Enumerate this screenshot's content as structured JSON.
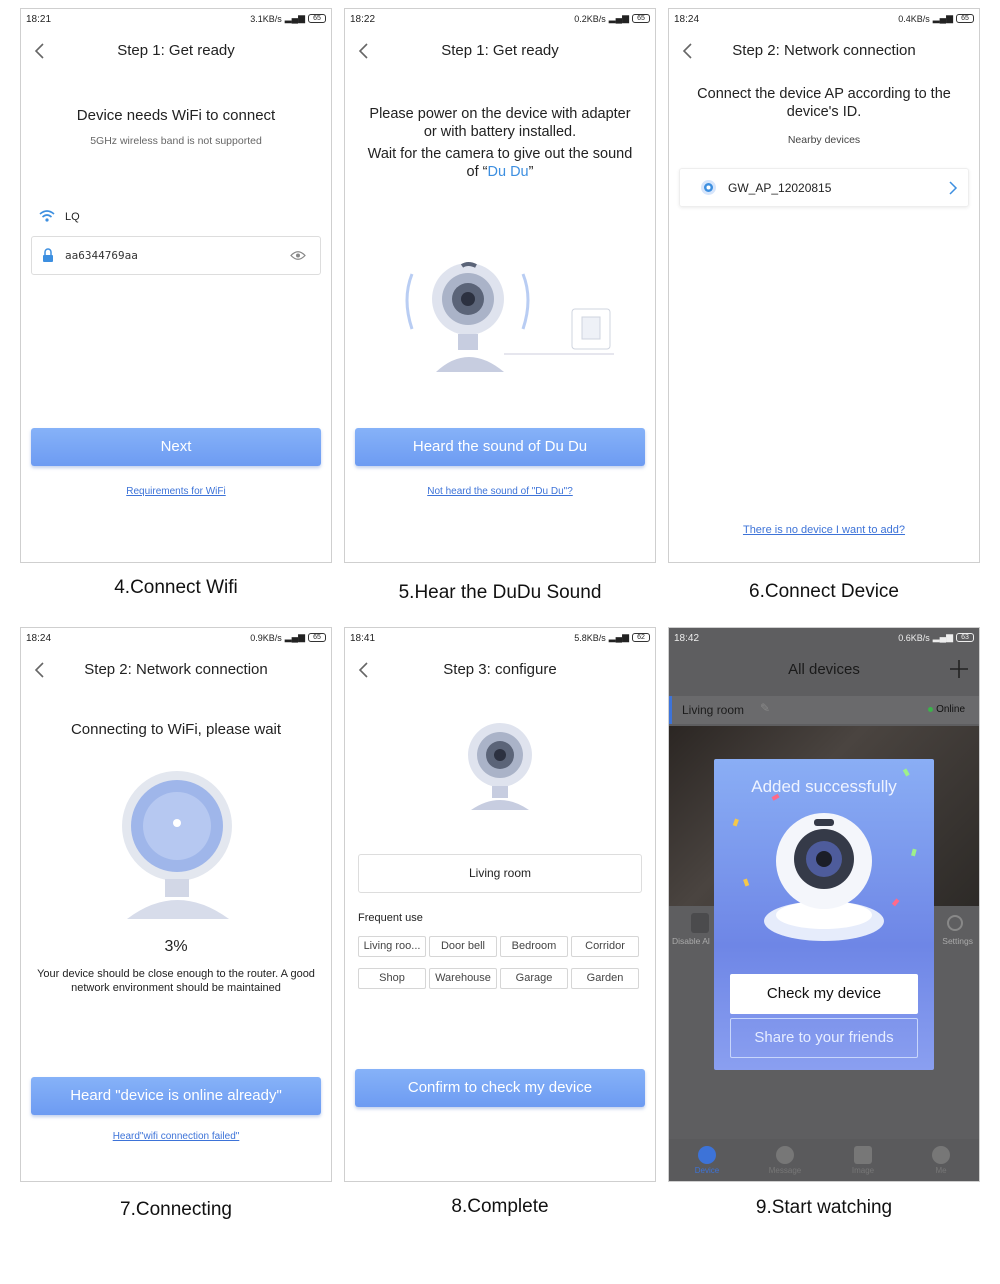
{
  "p1": {
    "time": "18:21",
    "speed": "3.1KB/s",
    "battery": "65",
    "title": "Step 1: Get ready",
    "heading": "Device needs WiFi to connect",
    "note": "5GHz wireless band is not supported",
    "wifi_name": "LQ",
    "password": "aa6344769aa",
    "button": "Next",
    "link": "Requirements for WiFi",
    "caption": "4.Connect Wifi"
  },
  "p2": {
    "time": "18:22",
    "speed": "0.2KB/s",
    "battery": "65",
    "title": "Step 1: Get ready",
    "line1": "Please power on the device with adapter",
    "line2": "or with battery installed.",
    "line3": "Wait for the camera to give out the sound",
    "line4_prefix": "of “",
    "line4_highlight": "Du Du",
    "line4_suffix": "”",
    "button": "Heard the sound of Du Du",
    "link": "Not heard the sound of \"Du Du\"?",
    "caption": "5.Hear the DuDu Sound"
  },
  "p3": {
    "time": "18:24",
    "speed": "0.4KB/s",
    "battery": "65",
    "title": "Step 2: Network connection",
    "heading1": "Connect the device AP according to the",
    "heading2": "device's ID.",
    "sub": "Nearby devices",
    "device": "GW_AP_12020815",
    "link": "There is no device I want to add?",
    "caption": "6.Connect Device"
  },
  "p4": {
    "time": "18:24",
    "speed": "0.9KB/s",
    "battery": "65",
    "title": "Step 2: Network connection",
    "heading": "Connecting to WiFi, please wait",
    "progress_text": "3%",
    "progress": 0.03,
    "note1": "Your device should be close enough to the router. A good",
    "note2": "network environment should be maintained",
    "button": "Heard \"device is online already\"",
    "link": "Heard\"wifi connection failed\"",
    "caption": "7.Connecting"
  },
  "p5": {
    "time": "18:41",
    "speed": "5.8KB/s",
    "battery": "62",
    "title": "Step 3: configure",
    "name_value": "Living room",
    "frequent_label": "Frequent use",
    "chips": [
      "Living roo...",
      "Door bell",
      "Bedroom",
      "Corridor",
      "Shop",
      "Warehouse",
      "Garage",
      "Garden"
    ],
    "button": "Confirm to check my device",
    "caption": "8.Complete"
  },
  "p6": {
    "time": "18:42",
    "speed": "0.6KB/s",
    "battery": "63",
    "title": "All devices",
    "room": "Living room",
    "status": "Online",
    "side_left": "Disable Al",
    "side_right": "Settings",
    "popup_title": "Added successfully",
    "check_button": "Check my device",
    "share_button": "Share to your friends",
    "tabs": [
      "Device",
      "Message",
      "Image",
      "Me"
    ],
    "caption": "9.Start watching"
  },
  "colors": {
    "accent": "#6d9bf2",
    "link": "#3d73d8",
    "online": "#3bb34a",
    "highlight": "#3d8fe0"
  }
}
